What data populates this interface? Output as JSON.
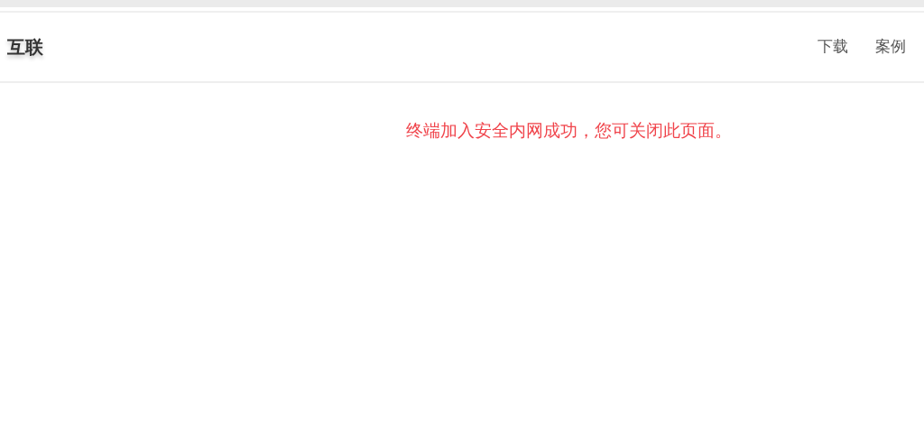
{
  "header": {
    "brand": "互联",
    "nav": [
      {
        "label": "下载"
      },
      {
        "label": "案例"
      }
    ]
  },
  "message": "终端加入安全内网成功，您可关闭此页面。"
}
